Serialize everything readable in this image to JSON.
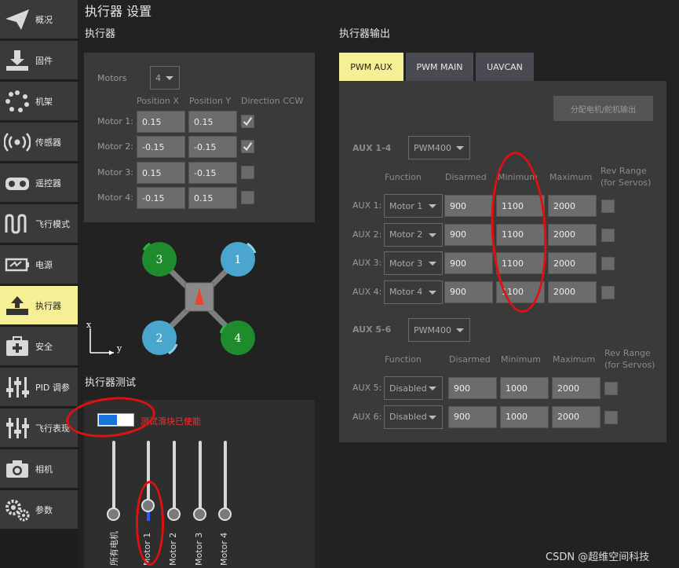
{
  "nav": [
    {
      "label": "概况",
      "icon": "paper-plane-icon",
      "active": false
    },
    {
      "label": "固件",
      "icon": "download-icon",
      "active": false
    },
    {
      "label": "机架",
      "icon": "dots-circle-icon",
      "active": false
    },
    {
      "label": "传感器",
      "icon": "radio-waves-icon",
      "active": false
    },
    {
      "label": "遥控器",
      "icon": "gamepad-icon",
      "active": false
    },
    {
      "label": "飞行模式",
      "icon": "wave-icon",
      "active": false
    },
    {
      "label": "电源",
      "icon": "battery-icon",
      "active": false
    },
    {
      "label": "执行器",
      "icon": "actuator-icon",
      "active": true
    },
    {
      "label": "安全",
      "icon": "first-aid-icon",
      "active": false
    },
    {
      "label": "PID 调参",
      "icon": "sliders-icon",
      "active": false
    },
    {
      "label": "飞行表现",
      "icon": "sliders-icon",
      "active": false
    },
    {
      "label": "相机",
      "icon": "camera-icon",
      "active": false
    },
    {
      "label": "参数",
      "icon": "gears-icon",
      "active": false
    }
  ],
  "page_title": "执行器 设置",
  "actuators": {
    "section_title": "执行器",
    "motors_label": "Motors",
    "motors_count": "4",
    "col_x": "Position X",
    "col_y": "Position Y",
    "col_ccw": "Direction CCW",
    "rows": [
      {
        "label": "Motor 1:",
        "x": "0.15",
        "y": "0.15",
        "ccw": true
      },
      {
        "label": "Motor 2:",
        "x": "-0.15",
        "y": "-0.15",
        "ccw": true
      },
      {
        "label": "Motor 3:",
        "x": "0.15",
        "y": "-0.15",
        "ccw": false
      },
      {
        "label": "Motor 4:",
        "x": "-0.15",
        "y": "0.15",
        "ccw": false
      }
    ]
  },
  "diagram": {
    "motor_labels": [
      "3",
      "1",
      "2",
      "4"
    ],
    "axis_x": "x",
    "axis_y": "y",
    "colors": {
      "green": "#1e8c2c",
      "blue": "#4aa6cf",
      "body": "#888888",
      "arrow": "#e8472e"
    }
  },
  "test": {
    "section_title": "执行器测试",
    "toggle_label": "测试滑块已使能",
    "sliders": [
      {
        "label": "所有电机",
        "level": 0
      },
      {
        "label": "Motor 1",
        "level": 0
      },
      {
        "label": "Motor 2",
        "level": 0
      },
      {
        "label": "Motor 3",
        "level": 0
      },
      {
        "label": "Motor 4",
        "level": 0
      }
    ]
  },
  "outputs": {
    "section_title": "执行器输出",
    "tabs": [
      {
        "label": "PWM AUX",
        "active": true
      },
      {
        "label": "PWM MAIN",
        "active": false
      },
      {
        "label": "UAVCAN",
        "active": false
      }
    ],
    "assign_button": "分配电机/舵机输出",
    "group1": {
      "label": "AUX 1-4",
      "protocol": "PWM400",
      "headers": [
        "Function",
        "Disarmed",
        "Minimum",
        "Maximum",
        "Rev Range\n(for Servos)"
      ],
      "rows": [
        {
          "label": "AUX 1:",
          "function": "Motor 1",
          "disarmed": "900",
          "min": "1100",
          "max": "2000"
        },
        {
          "label": "AUX 2:",
          "function": "Motor 2",
          "disarmed": "900",
          "min": "1100",
          "max": "2000"
        },
        {
          "label": "AUX 3:",
          "function": "Motor 3",
          "disarmed": "900",
          "min": "1100",
          "max": "2000"
        },
        {
          "label": "AUX 4:",
          "function": "Motor 4",
          "disarmed": "900",
          "min": "1100",
          "max": "2000"
        }
      ]
    },
    "group2": {
      "label": "AUX 5-6",
      "protocol": "PWM400",
      "headers": [
        "Function",
        "Disarmed",
        "Minimum",
        "Maximum",
        "Rev Range\n(for Servos)"
      ],
      "rows": [
        {
          "label": "AUX 5:",
          "function": "Disabled",
          "disarmed": "900",
          "min": "1000",
          "max": "2000"
        },
        {
          "label": "AUX 6:",
          "function": "Disabled",
          "disarmed": "900",
          "min": "1000",
          "max": "2000"
        }
      ]
    }
  },
  "watermark": "CSDN @超维空间科技"
}
